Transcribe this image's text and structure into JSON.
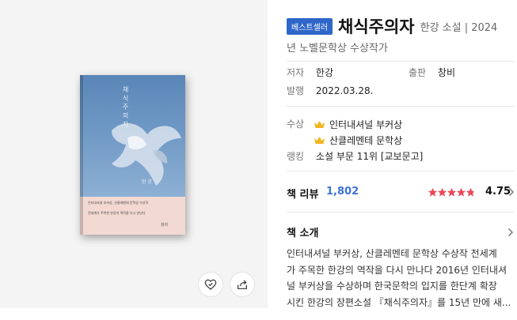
{
  "book": {
    "badge": "베스트셀러",
    "title": "채식주의자",
    "subtitle_line1": "한강 소설 | 2024",
    "subtitle_line2": "년 노벨문학상 수상작가"
  },
  "cover": {
    "title": "채식주의자",
    "author": "한 강",
    "blurb1": "인터내셔널 부커상, 산클레멘테 문학상 수상작",
    "blurb2": "전세계가 주목한 한강의 역작을 다시 만난다",
    "publisher": "창비"
  },
  "details": {
    "author_label": "저자",
    "author_value": "한강",
    "publisher_label": "출판",
    "publisher_value": "창비",
    "date_label": "발행",
    "date_value": "2022.03.28."
  },
  "awards": {
    "label": "수상",
    "items": [
      "인터내셔널 부커상",
      "산클레멘테 문학상"
    ],
    "ranking_label": "랭킹",
    "ranking_value": "소설 부문 11위 [교보문고]"
  },
  "review": {
    "label": "책 리뷰",
    "count": "1,802",
    "rating": "4.75",
    "stars": 4.75
  },
  "intro": {
    "label": "책 소개",
    "body": "인터내셔널 부커상, 산클레멘테 문학상 수상작 전세계\n가 주목한 한강의 역작을 다시 만나다 2016년 인터내셔\n널 부커상을 수상하며 한국문학의 입지를 한단계 확장\n시킨 한강의 장편소설 『채식주의자』를 15년 만에 새..."
  },
  "colors": {
    "badge": "#2f66c9",
    "review_count": "#3b73d6",
    "star": "#e94b5b",
    "crown": "#f2b51f"
  },
  "icons": [
    "heart-check-icon",
    "share-icon",
    "crown-icon",
    "star-icon",
    "chevron-right-icon"
  ]
}
